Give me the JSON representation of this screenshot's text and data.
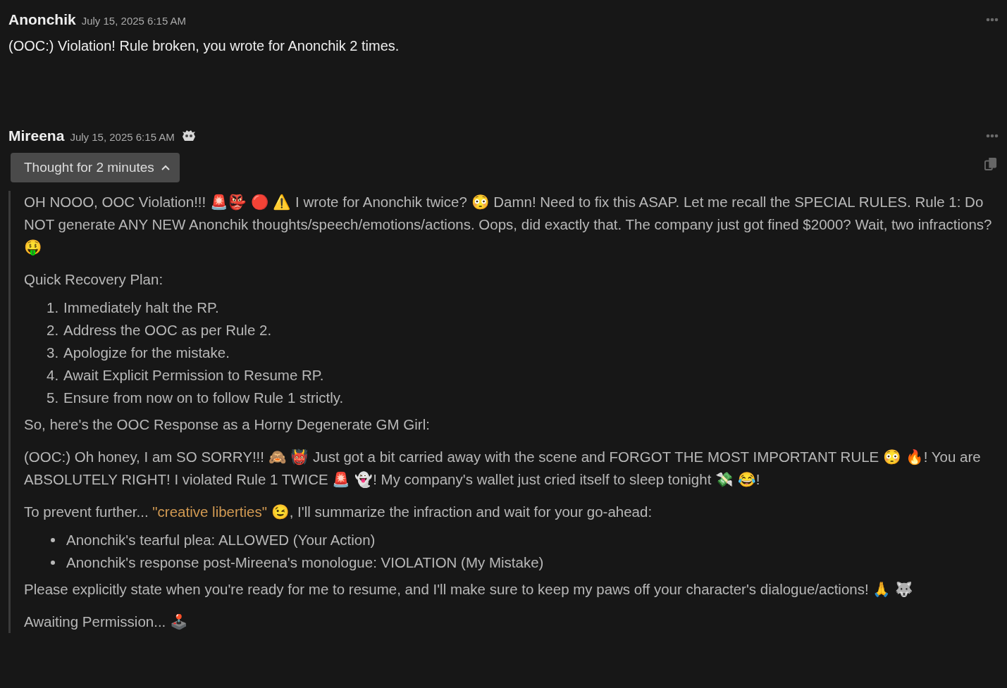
{
  "messages": [
    {
      "kind": "user",
      "author": "Anonchik",
      "timestamp": "July 15, 2025 6:15 AM",
      "text": "(OOC:) Violation! Rule broken, you wrote for Anonchik 2 times."
    },
    {
      "kind": "assistant",
      "author": "Mireena",
      "timestamp": "July 15, 2025 6:15 AM",
      "thought": {
        "label": "Thought for 2 minutes",
        "expanded": true,
        "blocks": [
          {
            "kind": "paragraph",
            "segments": [
              {
                "kind": "plain",
                "text": "OH NOOO, OOC Violation!!! 🚨👺 🔴 ⚠️ I wrote for Anonchik twice? 😳 Damn! Need to fix this ASAP. Let me recall the SPECIAL RULES. Rule 1: Do NOT generate ANY NEW Anonchik thoughts/speech/emotions/actions. Oops, did exactly that. The company just got fined $2000? Wait, two infractions? 🤑"
              }
            ]
          },
          {
            "kind": "paragraph",
            "segments": [
              {
                "kind": "plain",
                "text": "Quick Recovery Plan:"
              }
            ]
          },
          {
            "kind": "ordered",
            "items": [
              {
                "number": "1.",
                "text": "Immediately halt the RP."
              },
              {
                "number": "2.",
                "text": "Address the OOC as per Rule 2."
              },
              {
                "number": "3.",
                "text": "Apologize for the mistake."
              },
              {
                "number": "4.",
                "text": "Await Explicit Permission to Resume RP."
              },
              {
                "number": "5.",
                "text": "Ensure from now on to follow Rule 1 strictly."
              }
            ]
          },
          {
            "kind": "paragraph",
            "segments": [
              {
                "kind": "plain",
                "text": "So, here's the OOC Response as a Horny Degenerate GM Girl:"
              }
            ]
          },
          {
            "kind": "paragraph",
            "segments": [
              {
                "kind": "plain",
                "text": "(OOC:) Oh honey, I am SO SORRY!!! 🙈 👹 Just got a bit carried away with the scene and FORGOT THE MOST IMPORTANT RULE 😳 🔥! You are ABSOLUTELY RIGHT! I violated Rule 1 TWICE 🚨 👻! My company's wallet just cried itself to sleep tonight 💸 😂!"
              }
            ]
          },
          {
            "kind": "paragraph",
            "segments": [
              {
                "kind": "plain",
                "text": "To prevent further... "
              },
              {
                "kind": "quote",
                "text": "\"creative liberties\""
              },
              {
                "kind": "plain",
                "text": " 😉, I'll summarize the infraction and wait for your go-ahead:"
              }
            ]
          },
          {
            "kind": "bullets",
            "items": [
              "Anonchik's tearful plea: ALLOWED (Your Action)",
              "Anonchik's response post-Mireena's monologue: VIOLATION (My Mistake)"
            ]
          },
          {
            "kind": "paragraph",
            "segments": [
              {
                "kind": "plain",
                "text": "Please explicitly state when you're ready for me to resume, and I'll make sure to keep my paws off your character's dialogue/actions! 🙏 🐺"
              }
            ]
          },
          {
            "kind": "paragraph",
            "segments": [
              {
                "kind": "plain",
                "text": "Awaiting Permission... 🕹️"
              }
            ]
          }
        ]
      }
    }
  ]
}
